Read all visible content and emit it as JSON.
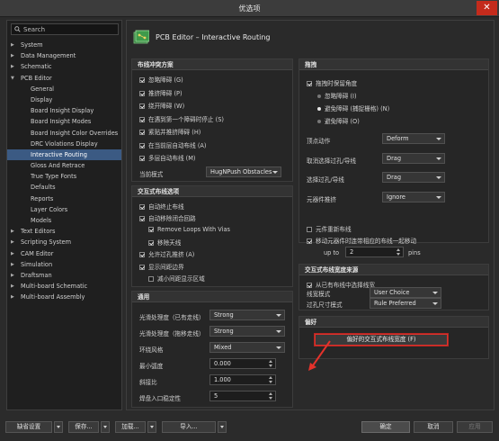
{
  "window": {
    "title": "优选项",
    "close_glyph": "✕"
  },
  "search": {
    "placeholder": "Search"
  },
  "tree": [
    {
      "label": "System",
      "level": 0,
      "arrow": "▶"
    },
    {
      "label": "Data Management",
      "level": 0,
      "arrow": "▶"
    },
    {
      "label": "Schematic",
      "level": 0,
      "arrow": "▶"
    },
    {
      "label": "PCB Editor",
      "level": 0,
      "arrow": "▼"
    },
    {
      "label": "General",
      "level": 1
    },
    {
      "label": "Display",
      "level": 1
    },
    {
      "label": "Board Insight Display",
      "level": 1
    },
    {
      "label": "Board Insight Modes",
      "level": 1
    },
    {
      "label": "Board Insight Color Overrides",
      "level": 1
    },
    {
      "label": "DRC Violations Display",
      "level": 1
    },
    {
      "label": "Interactive Routing",
      "level": 1,
      "selected": true
    },
    {
      "label": "Gloss And Retrace",
      "level": 1
    },
    {
      "label": "True Type Fonts",
      "level": 1
    },
    {
      "label": "Defaults",
      "level": 1
    },
    {
      "label": "Reports",
      "level": 1
    },
    {
      "label": "Layer Colors",
      "level": 1
    },
    {
      "label": "Models",
      "level": 1
    },
    {
      "label": "Text Editors",
      "level": 0,
      "arrow": "▶"
    },
    {
      "label": "Scripting System",
      "level": 0,
      "arrow": "▶"
    },
    {
      "label": "CAM Editor",
      "level": 0,
      "arrow": "▶"
    },
    {
      "label": "Simulation",
      "level": 0,
      "arrow": "▶"
    },
    {
      "label": "Draftsman",
      "level": 0,
      "arrow": "▶"
    },
    {
      "label": "Multi-board Schematic",
      "level": 0,
      "arrow": "▶"
    },
    {
      "label": "Multi-board Assembly",
      "level": 0,
      "arrow": "▶"
    }
  ],
  "page_title": "PCB Editor – Interactive Routing",
  "conflict": {
    "title": "布线冲突方案",
    "options": [
      {
        "label": "忽略障碍 (G)",
        "checked": true
      },
      {
        "label": "推挤障碍 (P)",
        "checked": true
      },
      {
        "label": "绕开障碍 (W)",
        "checked": true
      },
      {
        "label": "在遇到第一个障碍时停止 (S)",
        "checked": true
      },
      {
        "label": "紧贴并推挤障碍 (H)",
        "checked": true
      },
      {
        "label": "在当前层自动布线 (A)",
        "checked": true
      },
      {
        "label": "多层自动布线 (M)",
        "checked": true
      }
    ],
    "mode_label": "当前模式",
    "mode_value": "HugNPush Obstacles"
  },
  "options": {
    "title": "交互式布线选项",
    "items": [
      {
        "label": "自动终止布线",
        "checked": true,
        "indent": false
      },
      {
        "label": "自动移除闭合回路",
        "checked": true,
        "indent": false
      },
      {
        "label": "Remove Loops With Vias",
        "checked": true,
        "indent": true
      },
      {
        "label": "移除天线",
        "checked": true,
        "indent": true
      },
      {
        "label": "允许过孔推挤 (A)",
        "checked": true,
        "indent": false
      },
      {
        "label": "显示间距边界",
        "checked": true,
        "indent": false
      },
      {
        "label": "减小间距显示区域",
        "checked": false,
        "indent": true
      }
    ]
  },
  "general": {
    "title": "通用",
    "rows": [
      {
        "label": "光滑处理度（已有走线）",
        "value": "Strong",
        "type": "combo"
      },
      {
        "label": "光滑处理度（拖移走线）",
        "value": "Strong",
        "type": "combo"
      },
      {
        "label": "环绕风格",
        "value": "Mixed",
        "type": "combo"
      },
      {
        "label": "最小弧度",
        "value": "0.000",
        "type": "spin"
      },
      {
        "label": "斜接比",
        "value": "1.000",
        "type": "spin"
      },
      {
        "label": "焊盘入口稳定性",
        "value": "5",
        "type": "spin"
      }
    ]
  },
  "drag": {
    "title": "拖拽",
    "keep_angle": {
      "label": "拖拽时保留角度",
      "checked": true
    },
    "radios": [
      {
        "label": "忽略障碍 (I)",
        "on": false
      },
      {
        "label": "避免障碍 (捕捉栅格) (N)",
        "on": true
      },
      {
        "label": "避免障碍 (O)",
        "on": false
      }
    ],
    "rows": [
      {
        "label": "顶点动作",
        "value": "Deform"
      },
      {
        "label": "取消选择过孔/导线",
        "value": "Drag"
      },
      {
        "label": "选择过孔/导线",
        "value": "Drag"
      },
      {
        "label": "元器件推挤",
        "value": "Ignore"
      }
    ],
    "reroute": {
      "label": "元件重新布线",
      "checked": false
    },
    "move_together": {
      "label": "移动元器件时连带相应的布线一起移动",
      "checked": true
    },
    "upto_label": "up to",
    "upto_value": "2",
    "pins_label": "pins"
  },
  "width_source": {
    "title": "交互式布线宽度来源",
    "pick_from_existing": {
      "label": "从已有布线中选择线宽",
      "checked": true
    },
    "rows": [
      {
        "label": "线宽模式",
        "value": "User Choice"
      },
      {
        "label": "过孔尺寸模式",
        "value": "Rule Preferred"
      }
    ]
  },
  "favorites": {
    "title": "偏好",
    "button_label": "偏好的交互式布线宽度 (F)"
  },
  "footer": {
    "default_label": "缺省设置",
    "save_label": "保存...",
    "load_label": "加载...",
    "import_label": "导入...",
    "ok_label": "确定",
    "cancel_label": "取消",
    "apply_label": "应用"
  },
  "colors": {
    "accent_selected": "#3b5a83",
    "highlight_red": "#d9332c"
  }
}
